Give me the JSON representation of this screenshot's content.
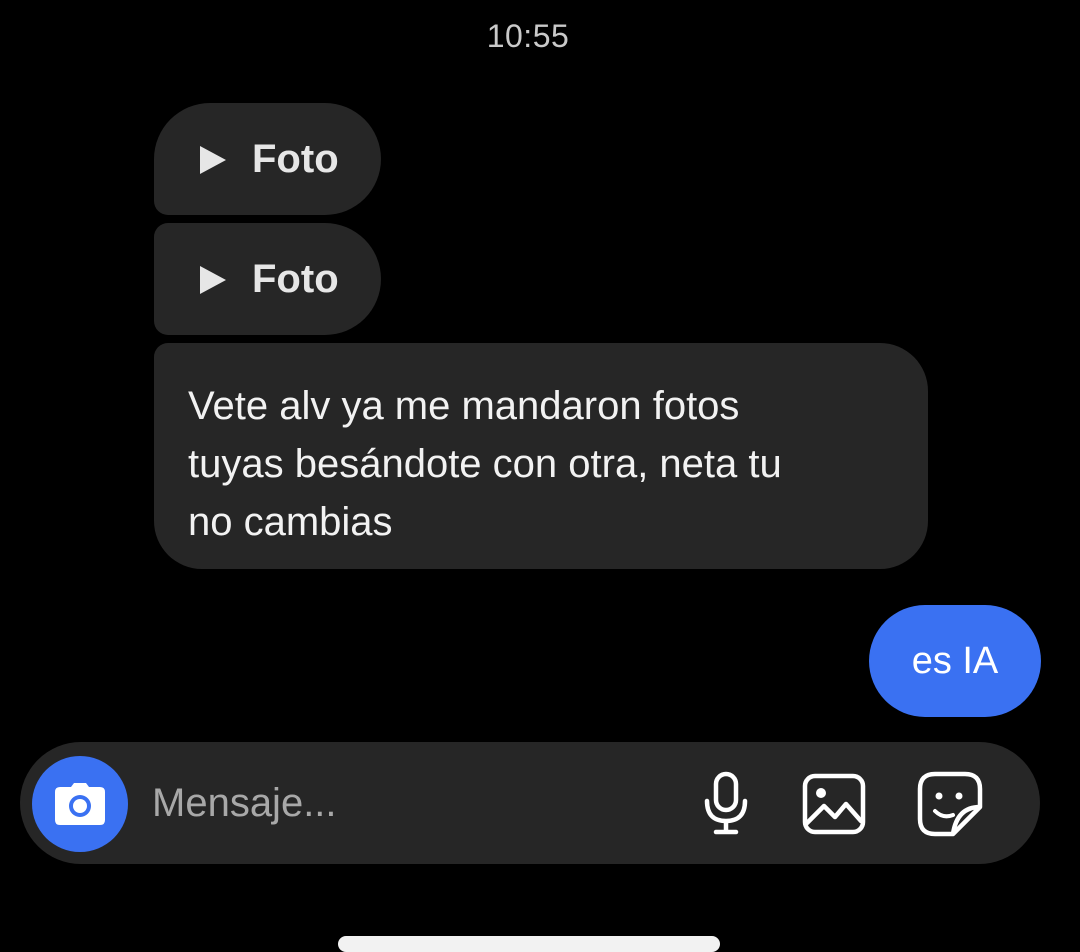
{
  "header": {
    "time": "10:55"
  },
  "messages": [
    {
      "type": "media",
      "label": "Foto",
      "icon": "play-icon"
    },
    {
      "type": "media",
      "label": "Foto",
      "icon": "play-icon"
    },
    {
      "type": "text",
      "text": "Vete alv ya me mandaron fotos\ntuyas besándote con otra, neta tu\nno cambias"
    }
  ],
  "sent": {
    "text": "es IA"
  },
  "composer": {
    "placeholder": "Mensaje...",
    "icons": [
      "camera-icon",
      "microphone-icon",
      "gallery-icon",
      "sticker-icon"
    ]
  },
  "colors": {
    "background": "#000000",
    "received_bubble": "#262626",
    "sent_bubble": "#3a71f2",
    "accent": "#3a71f2"
  }
}
